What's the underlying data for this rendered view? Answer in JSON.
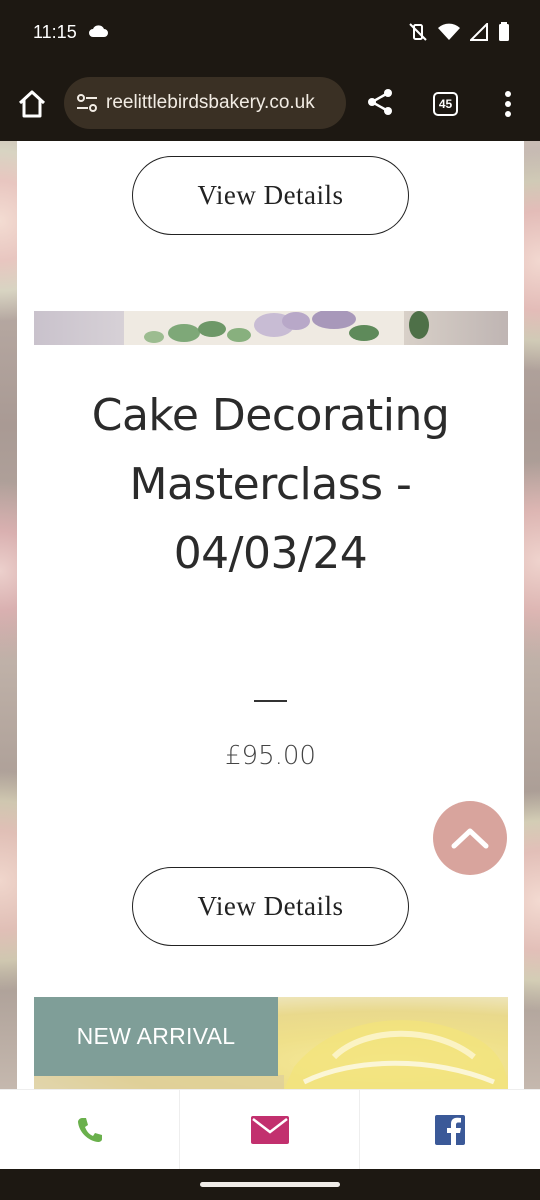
{
  "status_bar": {
    "time": "11:15"
  },
  "browser": {
    "url": "reelittlebirdsbakery.co.uk",
    "tab_count": "45"
  },
  "page": {
    "view_details_label": "View Details",
    "product": {
      "title": "Cake Decorating Masterclass - 04/03/24",
      "price": "£95.00"
    },
    "new_arrival_label": "NEW ARRIVAL"
  },
  "colors": {
    "badge": "#7f9e98",
    "scroll_top": "#d8a49d",
    "phone": "#6ab04c",
    "mail": "#c2306e",
    "facebook": "#3b5998"
  },
  "icons": {
    "scroll_top": "chevron-up-icon",
    "phone": "phone-icon",
    "mail": "mail-icon",
    "facebook": "facebook-icon"
  }
}
